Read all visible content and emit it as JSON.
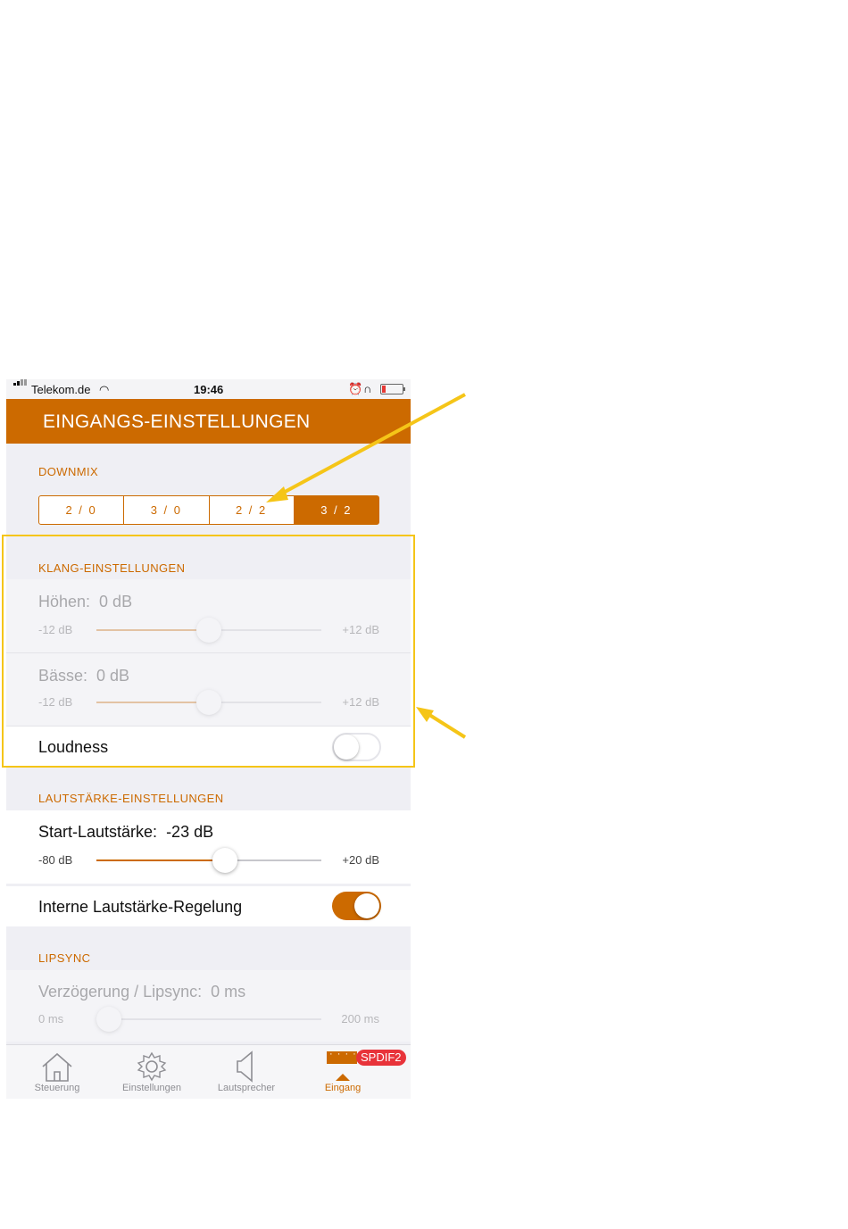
{
  "status": {
    "carrier": "Telekom.de",
    "time": "19:46"
  },
  "header": {
    "title": "EINGANGS-EINSTELLUNGEN"
  },
  "downmix": {
    "label": "DOWNMIX",
    "options": [
      "2 / 0",
      "3 / 0",
      "2 / 2",
      "3 / 2"
    ],
    "selected": "3 / 2"
  },
  "klang": {
    "label": "KLANG-EINSTELLUNGEN",
    "hoehen": {
      "title": "Höhen:",
      "value": "0 dB",
      "min": "-12 dB",
      "max": "+12 dB",
      "level": 0.5
    },
    "baesse": {
      "title": "Bässe:",
      "value": "0 dB",
      "min": "-12 dB",
      "max": "+12 dB",
      "level": 0.5
    },
    "loudness": {
      "label": "Loudness",
      "on": false
    }
  },
  "lautstaerke": {
    "label": "LAUTSTÄRKE-EINSTELLUNGEN",
    "start": {
      "title": "Start-Lautstärke:",
      "value": "-23 dB",
      "min": "-80 dB",
      "max": "+20 dB",
      "level": 0.57
    },
    "intern": {
      "label": "Interne Lautstärke-Regelung",
      "on": true
    }
  },
  "lipsync": {
    "label": "LIPSYNC",
    "delay": {
      "title": "Verzögerung / Lipsync:",
      "value": "0 ms",
      "min": "0 ms",
      "max": "200 ms",
      "level": 0.0
    }
  },
  "tabbar": {
    "items": [
      {
        "label": "Steuerung",
        "icon": "house-icon"
      },
      {
        "label": "Einstellungen",
        "icon": "gear-icon"
      },
      {
        "label": "Lautsprecher",
        "icon": "speaker-icon"
      },
      {
        "label": "Eingang",
        "icon": "input-icon"
      }
    ],
    "badge": "SPDIF2",
    "signal_dots": "· · · · ·"
  },
  "colors": {
    "accent": "#cc6a00",
    "highlight": "#f5c518",
    "badge": "#e8333a"
  }
}
